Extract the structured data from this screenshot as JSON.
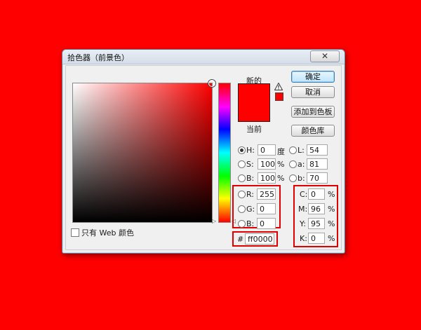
{
  "window": {
    "title": "拾色器（前景色）",
    "close_glyph": "✕"
  },
  "swatches": {
    "new_label": "新的",
    "current_label": "当前",
    "new_color": "#ff0000",
    "current_color": "#ff0000"
  },
  "buttons": {
    "ok": "确定",
    "cancel": "取消",
    "add_to_swatches": "添加到色板",
    "color_libraries": "颜色库"
  },
  "hsb": {
    "h_label": "H:",
    "h_value": "0",
    "h_unit": "度",
    "s_label": "S:",
    "s_value": "100",
    "s_unit": "%",
    "b_label": "B:",
    "b_value": "100",
    "b_unit": "%"
  },
  "lab": {
    "l_label": "L:",
    "l_value": "54",
    "a_label": "a:",
    "a_value": "81",
    "b_label": "b:",
    "b_value": "70"
  },
  "rgb": {
    "r_label": "R:",
    "r_value": "255",
    "g_label": "G:",
    "g_value": "0",
    "b_label": "B:",
    "b_value": "0"
  },
  "cmyk": {
    "c_label": "C:",
    "c_value": "0",
    "m_label": "M:",
    "m_value": "96",
    "y_label": "Y:",
    "y_value": "95",
    "k_label": "K:",
    "k_value": "0",
    "unit": "%"
  },
  "hex": {
    "label": "#",
    "value": "ff0000"
  },
  "web_only": {
    "label": "只有 Web 颜色",
    "checked": false
  },
  "colors": {
    "background": "#fe0000",
    "highlight_box": "#e00000",
    "picked": "#ff0000"
  }
}
